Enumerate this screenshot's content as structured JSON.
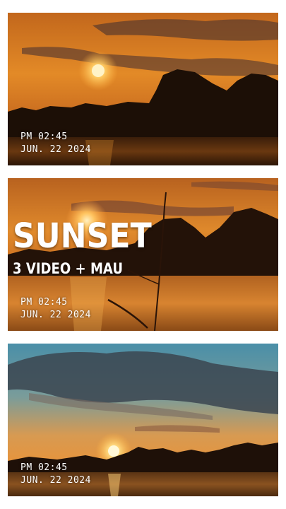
{
  "panels": [
    {
      "time": "PM 02:45",
      "date": "JUN. 22 2024"
    },
    {
      "time": "PM 02:45",
      "date": "JUN. 22 2024"
    },
    {
      "time": "PM 02:45",
      "date": "JUN. 22 2024"
    }
  ],
  "overlay": {
    "title": "SUNSET",
    "subtitle": "3 VIDEO + MAU"
  }
}
